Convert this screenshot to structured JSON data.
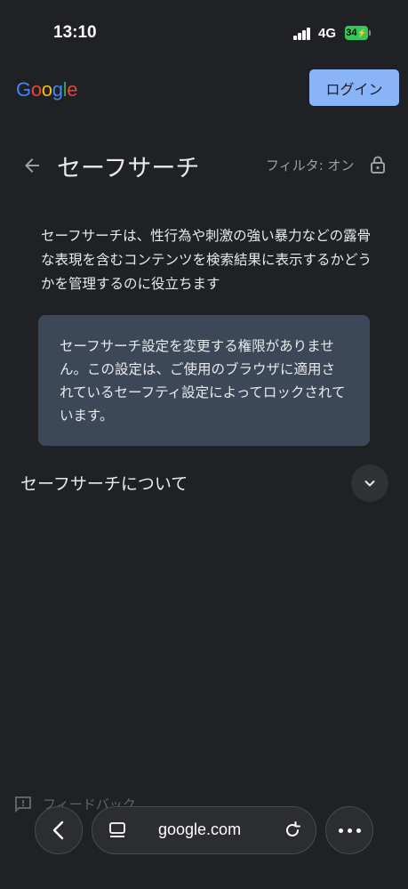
{
  "status_bar": {
    "time": "13:10",
    "network": "4G",
    "battery": "34"
  },
  "header": {
    "logo": [
      "G",
      "o",
      "o",
      "g",
      "l",
      "e"
    ],
    "logo_colors": [
      "#4285f4",
      "#ea4335",
      "#fbbc05",
      "#4285f4",
      "#34a853",
      "#ea4335"
    ],
    "login_label": "ログイン"
  },
  "page": {
    "title": "セーフサーチ",
    "filter_status": "フィルタ: オン",
    "description": "セーフサーチは、性行為や刺激の強い暴力などの露骨な表現を含むコンテンツを検索結果に表示するかどうかを管理するのに役立ちます",
    "info_message": "セーフサーチ設定を変更する権限がありません。この設定は、ご使用のブラウザに適用されているセーフティ設定によってロックされています。",
    "about_title": "セーフサーチについて",
    "feedback_label": "フィードバック"
  },
  "browser_bar": {
    "url": "google.com"
  },
  "colors": {
    "accent": "#8ab4f8",
    "background": "#202124",
    "info_box": "#3c4858"
  }
}
